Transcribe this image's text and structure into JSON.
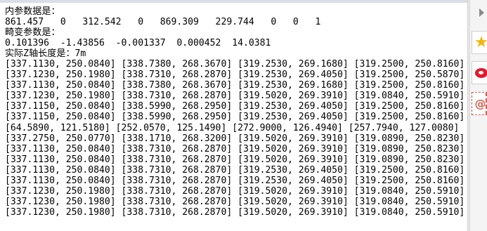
{
  "console": {
    "lines": [
      "内参数据是：",
      "861.457   0   312.542   0   869.309   229.744   0   0   1",
      "畸变参数是：",
      "0.101396  -1.43856  -0.001337  0.000452  14.0381",
      "实际Z轴长度是：7m",
      "[337.1130, 250.0840] [338.7380, 268.3670] [319.2530, 269.1680] [319.2500, 250.8160]",
      "[337.1230, 250.1980] [338.7310, 268.2870] [319.2530, 269.4050] [319.2500, 250.5870]",
      "[337.1130, 250.0840] [338.7380, 268.3670] [319.2530, 269.1680] [319.2500, 250.8160]",
      "[337.1230, 250.1980] [338.7310, 268.2870] [319.5020, 269.3910] [319.0840, 250.5910]",
      "[337.1150, 250.0840] [338.5990, 268.2950] [319.2530, 269.4050] [319.2500, 250.8160]",
      "[337.1150, 250.0840] [338.5990, 268.2950] [319.2530, 269.4050] [319.2500, 250.8160]",
      "[64.5890, 121.5180] [252.0570, 125.1490] [272.9000, 126.4940] [257.7940, 127.0080]",
      "[337.2750, 250.0770] [338.1710, 268.3200] [319.5020, 269.3910] [319.0890, 250.8230]",
      "[337.1130, 250.0840] [338.7310, 268.2870] [319.5020, 269.3910] [319.0890, 250.8230]",
      "[337.1130, 250.0840] [338.7310, 268.2870] [319.5020, 269.3910] [319.0890, 250.8230]",
      "[337.1130, 250.0840] [338.7310, 268.2870] [319.2530, 269.4050] [319.2500, 250.8160]",
      "[337.1130, 250.0840] [338.7310, 268.2870] [319.2530, 269.4050] [319.2500, 250.8160]",
      "[337.1230, 250.1980] [338.7310, 268.2870] [319.5020, 269.3910] [319.0840, 250.5910]",
      "[337.1230, 250.1980] [338.7310, 268.2870] [319.5020, 269.3910] [319.0840, 250.5910]",
      "[337.1230, 250.1980] [338.7310, 268.2870] [319.5020, 269.3910] [319.0840, 250.5910]"
    ]
  },
  "side_panel": {
    "icons": [
      "arrow-right-icon",
      "star-icon",
      "weibo-icon",
      "mail-icon"
    ],
    "star_glyph": "★",
    "mail_glyph": "@",
    "colors": {
      "star": "#f5b400",
      "weibo": "#e6162d",
      "mail": "#e25b4a"
    }
  }
}
